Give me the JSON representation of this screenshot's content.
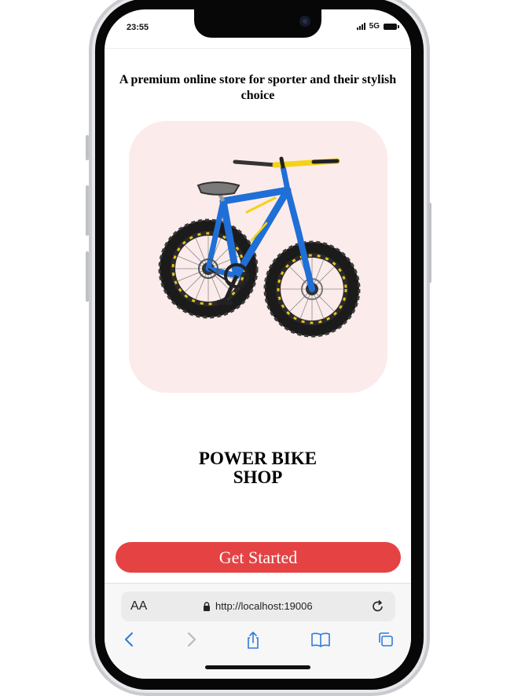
{
  "status_bar": {
    "time": "23:55",
    "network": "5G"
  },
  "main": {
    "tagline": "A premium online store for sporter and their stylish choice",
    "hero_image": {
      "subject": "blue fat-tire kids bike",
      "background": "#fcebeb"
    },
    "title_line1": "POWER BIKE",
    "title_line2": "SHOP",
    "cta_label": "Get Started"
  },
  "browser": {
    "text_size_label": "AA",
    "url": "http://localhost:19006",
    "icons": [
      "back-icon",
      "forward-icon",
      "share-icon",
      "bookmarks-icon",
      "tabs-icon",
      "lock-icon",
      "reload-icon"
    ]
  },
  "colors": {
    "accent": "#e54343",
    "hero_bg": "#fcebeb",
    "bike_blue": "#1f6fd6",
    "bike_yellow": "#f3d316"
  }
}
